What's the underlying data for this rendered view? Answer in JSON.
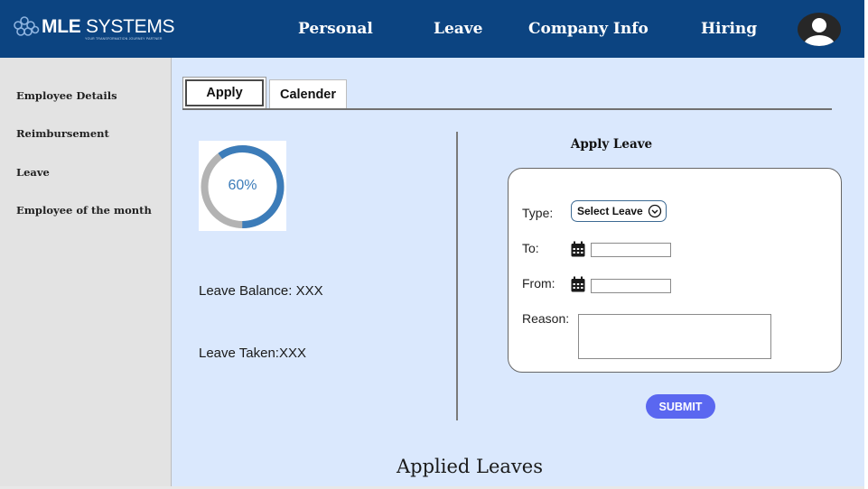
{
  "header": {
    "logo": {
      "name_bold": "MLE",
      "name_rest": " SYSTEMS",
      "tagline": "YOUR TRANSFORMATION JOURNEY PARTNER"
    },
    "nav": [
      "Personal",
      "Leave",
      "Company Info",
      "Hiring"
    ],
    "avatar_icon": "user-avatar-icon"
  },
  "sidebar": {
    "items": [
      "Employee Details",
      "Reimbursement",
      "Leave",
      "Employee of the month"
    ]
  },
  "main": {
    "tabs": [
      "Apply",
      "Calender"
    ],
    "active_tab": "Apply",
    "progress": {
      "percent": 60,
      "label": "60%",
      "color": "#3c7cb9",
      "track_color": "#b3b3b3"
    },
    "leave_balance": "Leave Balance: XXX",
    "leave_taken": "Leave Taken:XXX",
    "form": {
      "title": "Apply Leave",
      "type_label": "Type:",
      "select_value": "Select Leave",
      "to_label": "To:",
      "from_label": "From:",
      "reason_label": "Reason:",
      "to_value": "",
      "from_value": "",
      "reason_value": ""
    },
    "submit_label": "SUBMIT",
    "applied_leaves_title": "Applied Leaves"
  },
  "colors": {
    "header_bg": "#0c4481",
    "sidebar_bg": "#e3e3e3",
    "main_bg": "#dae8fd",
    "submit_bg": "#5a67f0"
  }
}
